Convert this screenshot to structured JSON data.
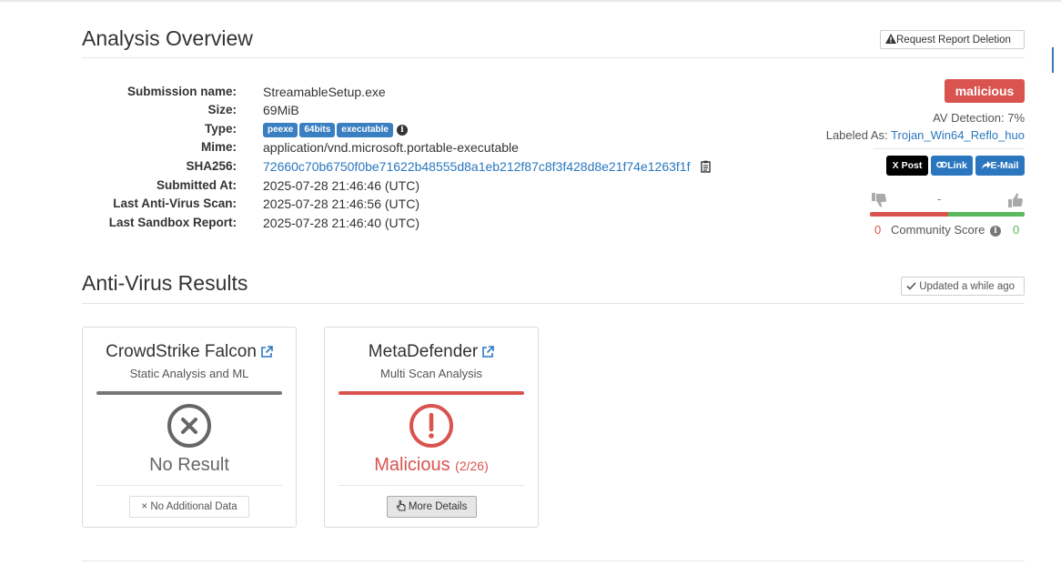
{
  "overview": {
    "title": "Analysis Overview",
    "request_deletion_label": "Request Report Deletion"
  },
  "info": {
    "rows": [
      {
        "label": "Submission name:",
        "value": "StreamableSetup.exe"
      },
      {
        "label": "Size:",
        "value": "69MiB"
      },
      {
        "label": "Type:",
        "tags": [
          "peexe",
          "64bits",
          "executable"
        ]
      },
      {
        "label": "Mime:",
        "value": "application/vnd.microsoft.portable-executable"
      },
      {
        "label": "SHA256:",
        "value": "72660c70b6750f0be71622b48555d8a1eb212f87c8f3f428d8e21f74e1263f1f"
      },
      {
        "label": "Submitted At:",
        "value": "2025-07-28 21:46:46 (UTC)"
      },
      {
        "label": "Last Anti-Virus Scan:",
        "value": "2025-07-28 21:46:56 (UTC)"
      },
      {
        "label": "Last Sandbox Report:",
        "value": "2025-07-28 21:46:40 (UTC)"
      }
    ]
  },
  "verdict": {
    "badge": "malicious",
    "av_detection": "AV Detection: 7%",
    "labeled_as_prefix": "Labeled As: ",
    "labeled_as": "Trojan_Win64_Reflo_huo",
    "share": {
      "x_post": "X Post",
      "link": "Link",
      "email": "E-Mail"
    },
    "community": {
      "dash": "-",
      "down": "0",
      "label": "Community Score",
      "up": "0"
    },
    "colors": {
      "malicious": "#d9534f",
      "good": "#5cb85c",
      "accent": "#2a77bf"
    }
  },
  "av": {
    "title": "Anti-Virus Results",
    "updated_label": "Updated a while ago",
    "cards": [
      {
        "name": "CrowdStrike Falcon",
        "sub": "Static Analysis and ML",
        "result": "No Result",
        "count": "",
        "button": "No Additional Data",
        "icon": "x-circle-icon",
        "color": "#777777"
      },
      {
        "name": "MetaDefender",
        "sub": "Multi Scan Analysis",
        "result": "Malicious",
        "count": "(2/26)",
        "button": "More Details",
        "icon": "exclamation-circle-icon",
        "color": "#d9534f"
      }
    ]
  }
}
